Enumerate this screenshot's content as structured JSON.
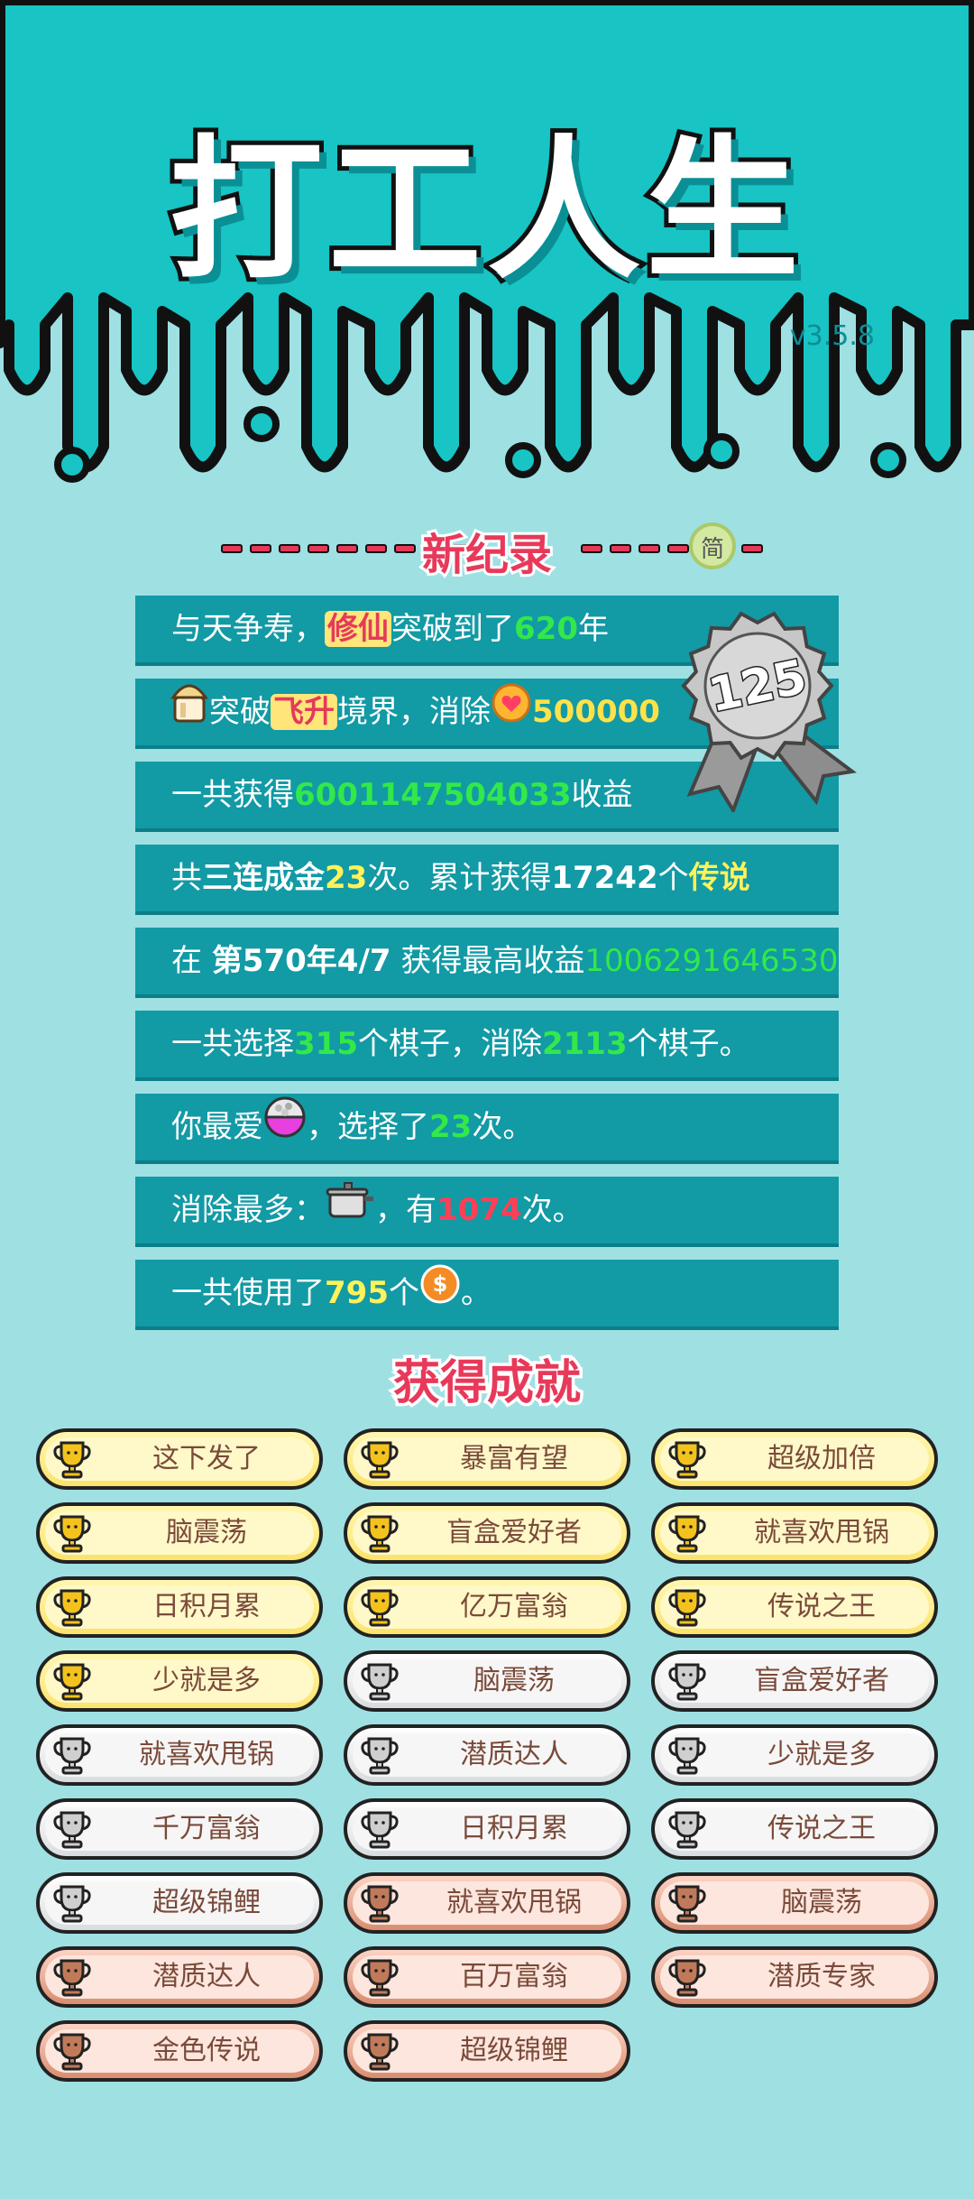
{
  "app": {
    "title": "打工人生",
    "version": "v3.5.8"
  },
  "record": {
    "title": "新纪录",
    "badge": "简",
    "medal_number": "125",
    "rows": [
      {
        "p1": "与天争寿，",
        "hl": "修仙",
        "p2": "突破到了",
        "num": "620",
        "p3": "年"
      },
      {
        "p1": "突破",
        "hl": "飞升",
        "p2": "境界，消除",
        "num": "500000"
      },
      {
        "p1": "一共获得",
        "num": "6001147504033",
        "p2": "收益"
      },
      {
        "p1": "共",
        "bold": "三连成金",
        "num": "23",
        "p2": "次。累计获得",
        "bold2": "17242",
        "p3": "个",
        "y": "传说"
      },
      {
        "p1": "在 ",
        "bold": "第570年4/7",
        "p2": " 获得最高收益",
        "num": "1006291646530"
      },
      {
        "p1": "一共选择",
        "num": "315",
        "p2": "个棋子，消除",
        "num2": "2113",
        "p3": "个棋子。"
      },
      {
        "p1": "你最爱",
        "p2": "，选择了",
        "num": "23",
        "p3": "次。"
      },
      {
        "p1": "消除最多：",
        "p2": "，有",
        "num": "1074",
        "p3": "次。"
      },
      {
        "p1": "一共使用了",
        "num": "795",
        "p2": "个",
        "p3": "。"
      }
    ]
  },
  "achievements": {
    "title": "获得成就",
    "items": [
      {
        "label": "这下发了",
        "tier": "gold"
      },
      {
        "label": "暴富有望",
        "tier": "gold"
      },
      {
        "label": "超级加倍",
        "tier": "gold"
      },
      {
        "label": "脑震荡",
        "tier": "gold"
      },
      {
        "label": "盲盒爱好者",
        "tier": "gold"
      },
      {
        "label": "就喜欢甩锅",
        "tier": "gold"
      },
      {
        "label": "日积月累",
        "tier": "gold"
      },
      {
        "label": "亿万富翁",
        "tier": "gold"
      },
      {
        "label": "传说之王",
        "tier": "gold"
      },
      {
        "label": "少就是多",
        "tier": "gold"
      },
      {
        "label": "脑震荡",
        "tier": "silver"
      },
      {
        "label": "盲盒爱好者",
        "tier": "silver"
      },
      {
        "label": "就喜欢甩锅",
        "tier": "silver"
      },
      {
        "label": "潜质达人",
        "tier": "silver"
      },
      {
        "label": "少就是多",
        "tier": "silver"
      },
      {
        "label": "千万富翁",
        "tier": "silver"
      },
      {
        "label": "日积月累",
        "tier": "silver"
      },
      {
        "label": "传说之王",
        "tier": "silver"
      },
      {
        "label": "超级锦鲤",
        "tier": "silver"
      },
      {
        "label": "就喜欢甩锅",
        "tier": "bronze"
      },
      {
        "label": "脑震荡",
        "tier": "bronze"
      },
      {
        "label": "潜质达人",
        "tier": "bronze"
      },
      {
        "label": "百万富翁",
        "tier": "bronze"
      },
      {
        "label": "潜质专家",
        "tier": "bronze"
      },
      {
        "label": "金色传说",
        "tier": "bronze"
      },
      {
        "label": "超级锦鲤",
        "tier": "bronze"
      }
    ]
  },
  "colors": {
    "background": "#9fe0e3",
    "header_teal": "#18c4c4",
    "row_bg": "#129aa5",
    "green": "#32e84a",
    "yellow": "#fff25a",
    "red": "#ff3f55"
  }
}
